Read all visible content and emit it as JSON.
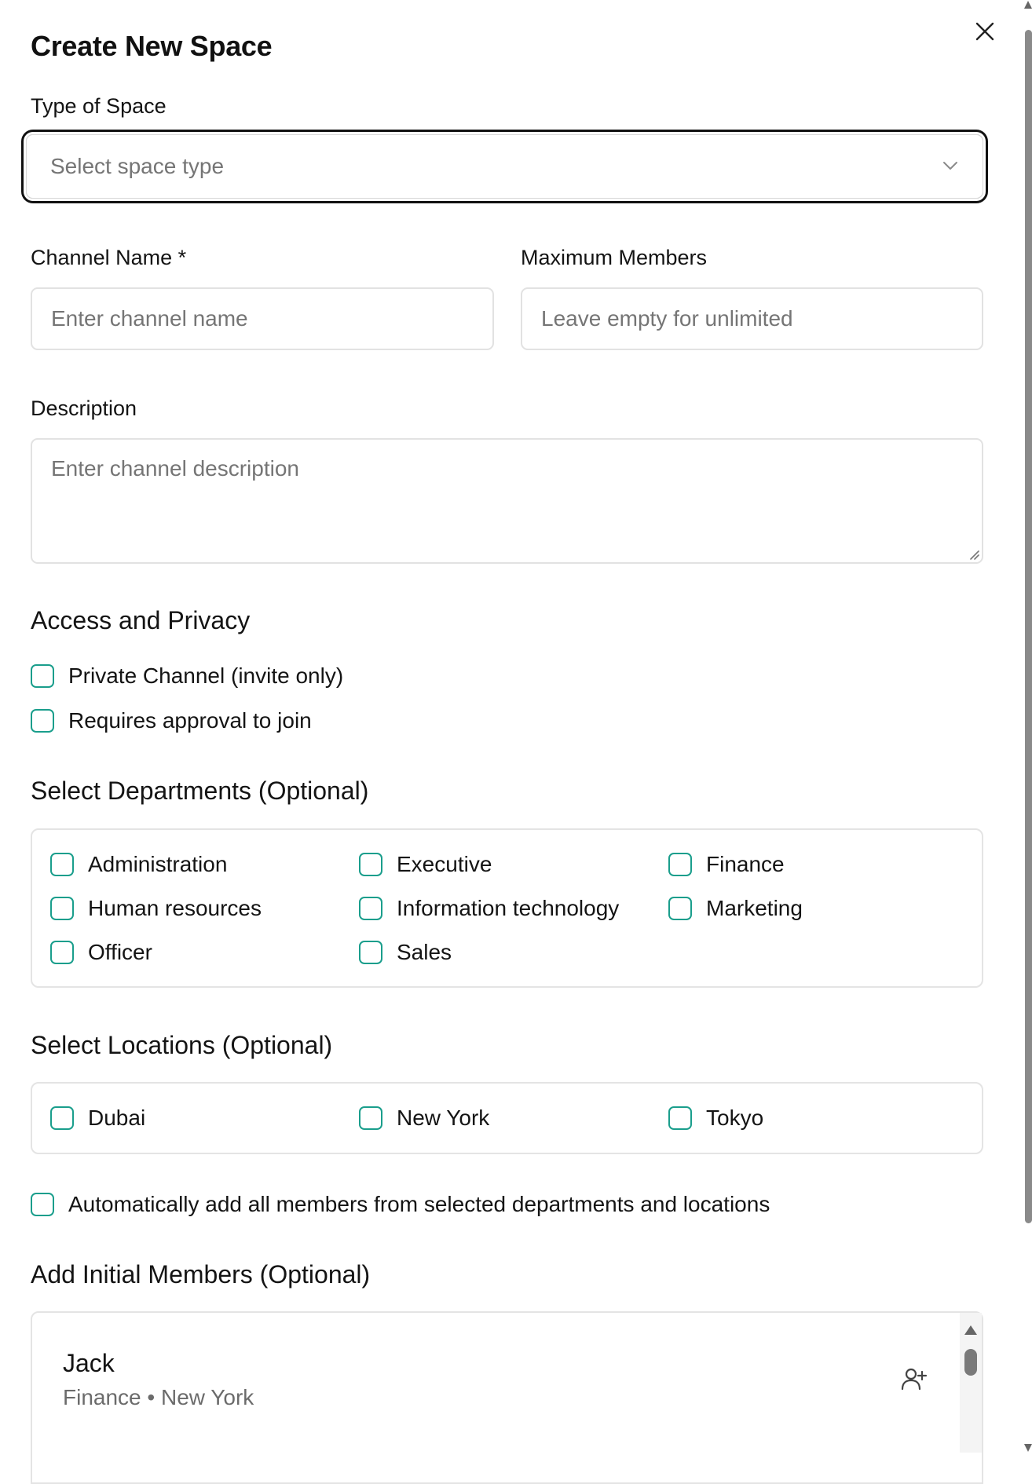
{
  "dialog": {
    "title": "Create New Space",
    "close_icon": "close-icon"
  },
  "space_type": {
    "label": "Type of Space",
    "placeholder": "Select space type",
    "icon": "chevron-down-icon"
  },
  "channel_name": {
    "label": "Channel Name *",
    "placeholder": "Enter channel name"
  },
  "max_members": {
    "label": "Maximum Members",
    "placeholder": "Leave empty for unlimited"
  },
  "description": {
    "label": "Description",
    "placeholder": "Enter channel description"
  },
  "access": {
    "title": "Access and Privacy",
    "options": [
      {
        "label": "Private Channel (invite only)",
        "checked": false
      },
      {
        "label": "Requires approval to join",
        "checked": false
      }
    ]
  },
  "departments": {
    "title": "Select Departments (Optional)",
    "items": [
      {
        "label": "Administration",
        "checked": false
      },
      {
        "label": "Executive",
        "checked": false
      },
      {
        "label": "Finance",
        "checked": false
      },
      {
        "label": "Human resources",
        "checked": false
      },
      {
        "label": "Information technology",
        "checked": false
      },
      {
        "label": "Marketing",
        "checked": false
      },
      {
        "label": "Officer",
        "checked": false
      },
      {
        "label": "Sales",
        "checked": false
      }
    ]
  },
  "locations": {
    "title": "Select Locations (Optional)",
    "items": [
      {
        "label": "Dubai",
        "checked": false
      },
      {
        "label": "New York",
        "checked": false
      },
      {
        "label": "Tokyo",
        "checked": false
      }
    ]
  },
  "auto_add": {
    "label": "Automatically add all members from selected departments and locations",
    "checked": false
  },
  "members": {
    "title": "Add Initial Members (Optional)",
    "list": [
      {
        "name": "Jack",
        "meta": "Finance • New York",
        "icon": "add-user-icon"
      }
    ]
  },
  "colors": {
    "checkbox_border": "#1a9e8c",
    "focus_ring": "#111111",
    "placeholder": "#757575"
  }
}
